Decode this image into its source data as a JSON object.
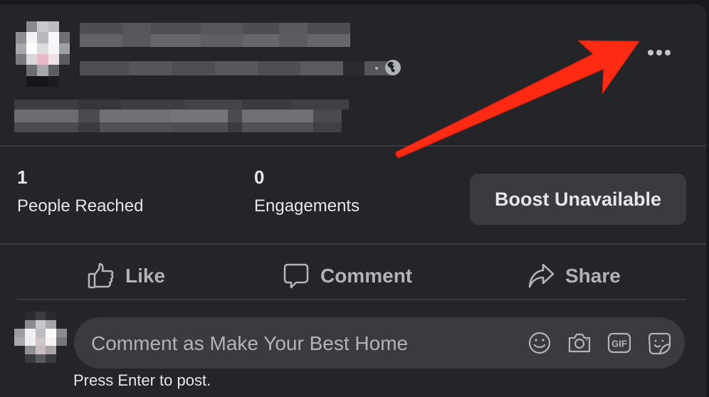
{
  "post": {
    "author_name_redacted": true,
    "privacy_icon": "globe-icon",
    "more_icon": "more-horizontal-icon"
  },
  "stats": {
    "people_reached": {
      "value": "1",
      "label": "People Reached"
    },
    "engagements": {
      "value": "0",
      "label": "Engagements"
    },
    "boost_label": "Boost Unavailable"
  },
  "actions": [
    {
      "label": "Like",
      "icon": "thumbs-up-icon"
    },
    {
      "label": "Comment",
      "icon": "comment-bubble-icon"
    },
    {
      "label": "Share",
      "icon": "share-arrow-icon"
    }
  ],
  "comment": {
    "placeholder": "Comment as Make Your Best Home",
    "value": "",
    "icons": [
      "emoji-icon",
      "camera-icon",
      "gif-icon",
      "sticker-icon"
    ],
    "hint": "Press Enter to post.",
    "gif_label": "GIF"
  },
  "annotation": {
    "type": "arrow",
    "color": "#ff2a12",
    "points_to": "more-options"
  },
  "colors": {
    "card_bg": "#242529",
    "button_bg": "#3a3b3f",
    "text_primary": "#e4e6eb",
    "text_secondary": "#b0b3b8"
  }
}
